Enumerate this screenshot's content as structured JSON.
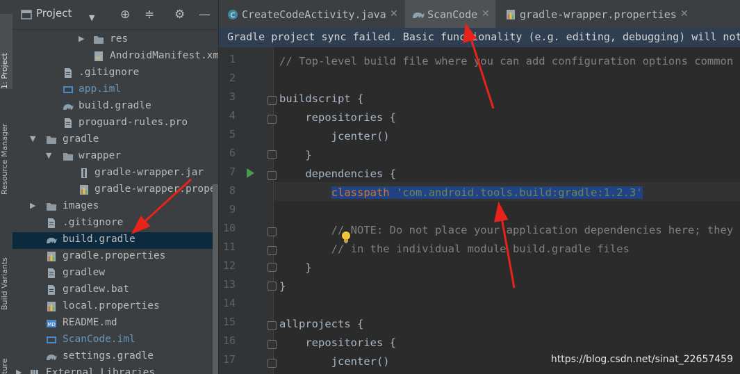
{
  "side_tabs": {
    "project": "1: Project",
    "resource_manager": "Resource Manager",
    "build_variants": "Build Variants",
    "structure": "ture"
  },
  "project_panel": {
    "title": "Project",
    "tree": [
      {
        "label": "res",
        "icon": "folder-icon",
        "arrow": "▶"
      },
      {
        "label": "AndroidManifest.xml",
        "icon": "manifest-icon",
        "arrow": ""
      },
      {
        "label": ".gitignore",
        "icon": "file-icon",
        "arrow": ""
      },
      {
        "label": "app.iml",
        "icon": "module-icon",
        "arrow": ""
      },
      {
        "label": "build.gradle",
        "icon": "gradle-icon",
        "arrow": ""
      },
      {
        "label": "proguard-rules.pro",
        "icon": "file-icon",
        "arrow": ""
      },
      {
        "label": "gradle",
        "icon": "folder-icon",
        "arrow": "▼"
      },
      {
        "label": "wrapper",
        "icon": "folder-icon",
        "arrow": "▼"
      },
      {
        "label": "gradle-wrapper.jar",
        "icon": "jar-icon",
        "arrow": ""
      },
      {
        "label": "gradle-wrapper.properties",
        "icon": "properties-icon",
        "arrow": ""
      },
      {
        "label": "images",
        "icon": "folder-icon",
        "arrow": "▶"
      },
      {
        "label": ".gitignore",
        "icon": "file-icon",
        "arrow": ""
      },
      {
        "label": "build.gradle",
        "icon": "gradle-icon",
        "arrow": ""
      },
      {
        "label": "gradle.properties",
        "icon": "properties-icon",
        "arrow": ""
      },
      {
        "label": "gradlew",
        "icon": "file-icon",
        "arrow": ""
      },
      {
        "label": "gradlew.bat",
        "icon": "file-icon",
        "arrow": ""
      },
      {
        "label": "local.properties",
        "icon": "properties-icon",
        "arrow": ""
      },
      {
        "label": "README.md",
        "icon": "markdown-icon",
        "arrow": ""
      },
      {
        "label": "ScanCode.iml",
        "icon": "module-icon",
        "arrow": ""
      },
      {
        "label": "settings.gradle",
        "icon": "gradle-icon",
        "arrow": ""
      },
      {
        "label": "External Libraries",
        "icon": "library-icon",
        "arrow": "▶"
      }
    ]
  },
  "editor_tabs": [
    {
      "label": "CreateCodeActivity.java",
      "icon": "java-class-icon"
    },
    {
      "label": "ScanCode",
      "icon": "gradle-icon"
    },
    {
      "label": "gradle-wrapper.properties",
      "icon": "properties-icon"
    }
  ],
  "banner": "Gradle project sync failed. Basic functionality (e.g. editing, debugging) will not",
  "line_numbers": [
    "1",
    "2",
    "3",
    "4",
    "5",
    "6",
    "7",
    "8",
    "9",
    "10",
    "11",
    "12",
    "13",
    "14",
    "15",
    "16",
    "17"
  ],
  "code": {
    "l1": "// Top-level build file where you can add configuration options common to",
    "l3": "buildscript {",
    "l4": "    repositories {",
    "l5": "        jcenter()",
    "l6": "    }",
    "l7": "    dependencies {",
    "l8_indent": "        ",
    "l8_kw": "classpath",
    "l8_str": " 'com.android.tools.build:gradle:1.2.3'",
    "l10": "        // NOTE: Do not place your application dependencies here; they bel",
    "l11": "        // in the individual module build.gradle files",
    "l12": "    }",
    "l13": "}",
    "l15": "allprojects {",
    "l16": "    repositories {",
    "l17": "        jcenter()"
  },
  "watermark": "https://blog.csdn.net/sinat_22657459",
  "colors": {
    "annotation_arrow": "#e8231b",
    "selection": "#214283",
    "banner_bg": "#303e52"
  }
}
